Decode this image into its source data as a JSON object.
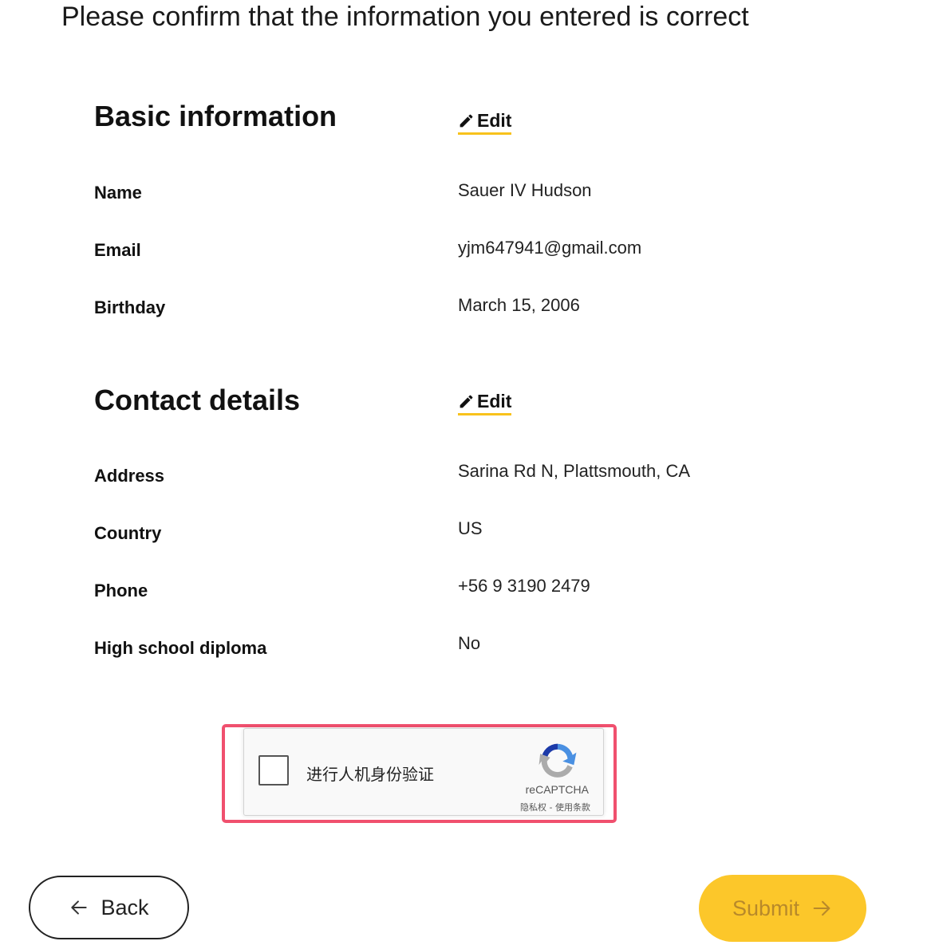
{
  "page": {
    "heading": "Please confirm that the information you entered is correct"
  },
  "sections": {
    "basic": {
      "title": "Basic information",
      "edit_label": "Edit",
      "fields": {
        "name": {
          "label": "Name",
          "value": "Sauer IV Hudson"
        },
        "email": {
          "label": "Email",
          "value": "yjm647941@gmail.com"
        },
        "birthday": {
          "label": "Birthday",
          "value": "March 15, 2006"
        }
      }
    },
    "contact": {
      "title": "Contact details",
      "edit_label": "Edit",
      "fields": {
        "address": {
          "label": "Address",
          "value": "Sarina Rd N, Plattsmouth, CA"
        },
        "country": {
          "label": "Country",
          "value": "US"
        },
        "phone": {
          "label": "Phone",
          "value": "+56 9 3190 2479"
        },
        "diploma": {
          "label": "High school diploma",
          "value": "No"
        }
      }
    }
  },
  "captcha": {
    "label": "进行人机身份验证",
    "brand": "reCAPTCHA",
    "privacy_link": "隐私权",
    "separator": " - ",
    "terms_link": "使用条款",
    "checked": false,
    "highlight_color": "#f0506e"
  },
  "actions": {
    "back_label": "Back",
    "submit_label": "Submit",
    "back_icon": "arrow-left-icon",
    "submit_icon": "arrow-right-icon",
    "submit_color": "#fcc72a",
    "accent_color": "#f8c21c"
  }
}
